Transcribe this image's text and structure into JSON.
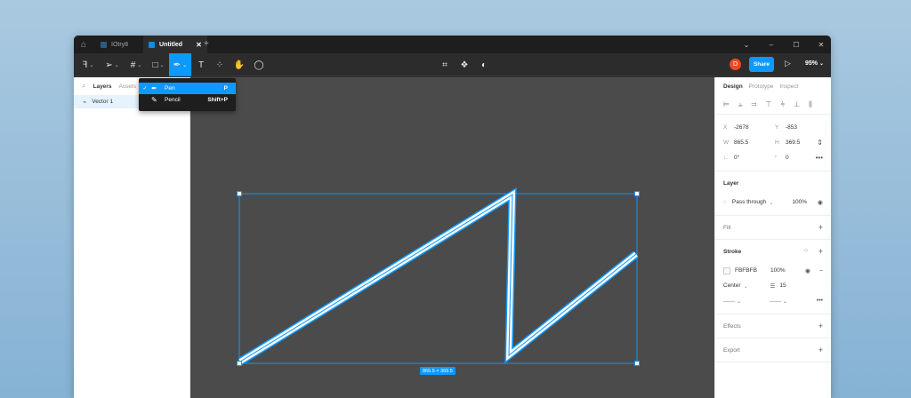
{
  "titlebar": {
    "tabs": [
      {
        "label": "IOtry8",
        "active": false
      },
      {
        "label": "Untitled",
        "active": true
      }
    ],
    "add_tab": "+",
    "controls": [
      "⌄",
      "–",
      "☐",
      "✕"
    ]
  },
  "toolbar": {
    "share_label": "Share",
    "zoom": "95%",
    "avatar_initial": "D"
  },
  "dropdown": {
    "items": [
      {
        "label": "Pen",
        "shortcut": "P",
        "selected": true
      },
      {
        "label": "Pencil",
        "shortcut": "Shift+P",
        "selected": false
      }
    ]
  },
  "left_panel": {
    "tabs": [
      "Layers",
      "Assets"
    ],
    "layers": [
      {
        "label": "Vector 1"
      }
    ]
  },
  "canvas": {
    "dimension_label": "865.5 × 369.5"
  },
  "right_panel": {
    "tabs": [
      "Design",
      "Prototype",
      "Inspect"
    ],
    "x": "-2678",
    "y": "-853",
    "w": "865.5",
    "h": "369.5",
    "rotation": "0°",
    "radius": "0",
    "layer": {
      "title": "Layer",
      "blend": "Pass through",
      "opacity": "100%"
    },
    "fill": {
      "title": "Fill"
    },
    "stroke": {
      "title": "Stroke",
      "color": "FBFBFB",
      "opacity": "100%",
      "position": "Center",
      "weight": "15"
    },
    "effects": {
      "title": "Effects"
    },
    "export": {
      "title": "Export"
    }
  },
  "colors": {
    "accent": "#0d99ff",
    "canvas": "#4b4b4b",
    "stroke": "#fbfbfb",
    "avatar": "#f24822"
  }
}
